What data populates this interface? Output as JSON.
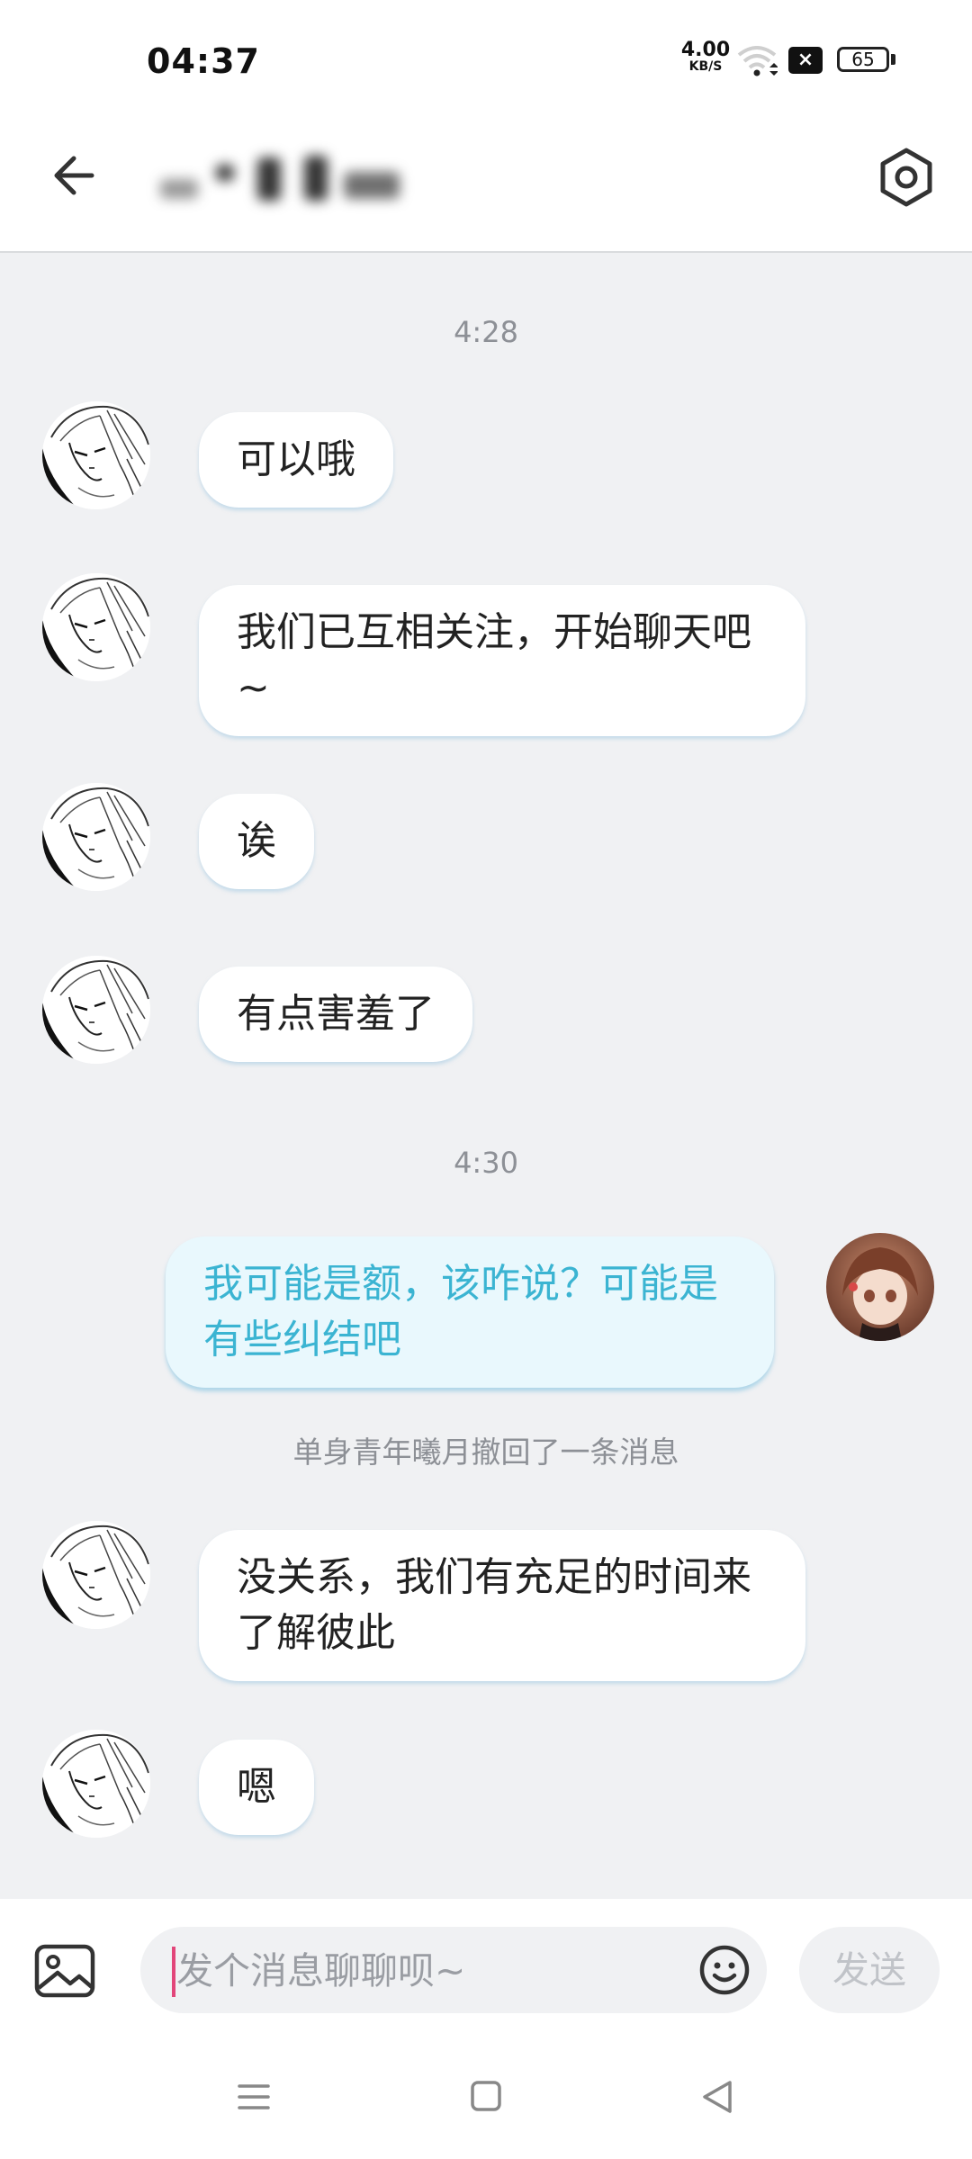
{
  "status_bar": {
    "time": "04:37",
    "net_speed_value": "4.00",
    "net_speed_unit": "KB/S",
    "sim_icon": "sim-x",
    "battery": "65"
  },
  "header": {
    "title_blurred": true,
    "back_icon": "arrow-left-icon",
    "settings_icon": "hexagon-settings-icon"
  },
  "messages": [
    {
      "type": "time",
      "text": "4:28"
    },
    {
      "type": "left",
      "text": "可以哦"
    },
    {
      "type": "left",
      "text": "我们已互相关注，开始聊天吧~"
    },
    {
      "type": "left",
      "text": "诶"
    },
    {
      "type": "left",
      "text": "有点害羞了"
    },
    {
      "type": "time",
      "text": "4:30"
    },
    {
      "type": "self",
      "text": "我可能是额，该咋说？可能是有些纠结吧"
    },
    {
      "type": "recall",
      "text": "单身青年曦月撤回了一条消息"
    },
    {
      "type": "left",
      "text": "没关系，我们有充足的时间来了解彼此"
    },
    {
      "type": "left",
      "text": "嗯"
    }
  ],
  "input": {
    "placeholder": "发个消息聊聊呗~",
    "value": "",
    "send_label": "发送"
  },
  "colors": {
    "background": "#f0f1f3",
    "self_bubble_bg": "#e9f8fd",
    "self_bubble_text": "#3bb4d2",
    "caret": "#e2467a"
  }
}
